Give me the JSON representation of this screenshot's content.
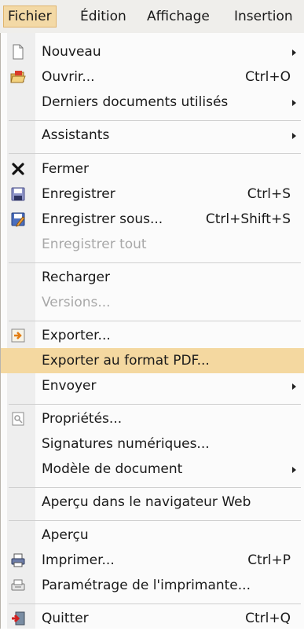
{
  "menubar": {
    "items": [
      {
        "label": "Fichier"
      },
      {
        "label": "Édition"
      },
      {
        "label": "Affichage"
      },
      {
        "label": "Insertion"
      }
    ]
  },
  "menu": {
    "items": [
      {
        "label": "Nouveau",
        "accel": "",
        "submenu": true,
        "icon": "new-document-icon"
      },
      {
        "label": "Ouvrir...",
        "accel": "Ctrl+O",
        "icon": "open-folder-icon"
      },
      {
        "label": "Derniers documents utilisés",
        "accel": "",
        "submenu": true
      },
      {
        "label": "Assistants",
        "accel": "",
        "submenu": true
      },
      {
        "label": "Fermer",
        "accel": "",
        "icon": "close-x-icon"
      },
      {
        "label": "Enregistrer",
        "accel": "Ctrl+S",
        "icon": "save-disk-icon"
      },
      {
        "label": "Enregistrer sous...",
        "accel": "Ctrl+Shift+S",
        "icon": "save-as-icon"
      },
      {
        "label": "Enregistrer tout",
        "disabled": true
      },
      {
        "label": "Recharger"
      },
      {
        "label": "Versions...",
        "disabled": true
      },
      {
        "label": "Exporter...",
        "icon": "export-icon"
      },
      {
        "label": "Exporter au format PDF...",
        "highlighted": true
      },
      {
        "label": "Envoyer",
        "submenu": true
      },
      {
        "label": "Propriétés...",
        "icon": "properties-icon"
      },
      {
        "label": "Signatures numériques..."
      },
      {
        "label": "Modèle de document",
        "submenu": true
      },
      {
        "label": "Aperçu dans le navigateur Web"
      },
      {
        "label": "Aperçu"
      },
      {
        "label": "Imprimer...",
        "accel": "Ctrl+P",
        "icon": "printer-icon"
      },
      {
        "label": "Paramétrage de l'imprimante...",
        "icon": "printer-setup-icon"
      },
      {
        "label": "Quitter",
        "accel": "Ctrl+Q",
        "icon": "quit-icon"
      }
    ]
  },
  "colors": {
    "highlight": "#f4d8a0",
    "menubar_bg": "#efeeeb",
    "disabled_text": "#a8a8a8"
  }
}
